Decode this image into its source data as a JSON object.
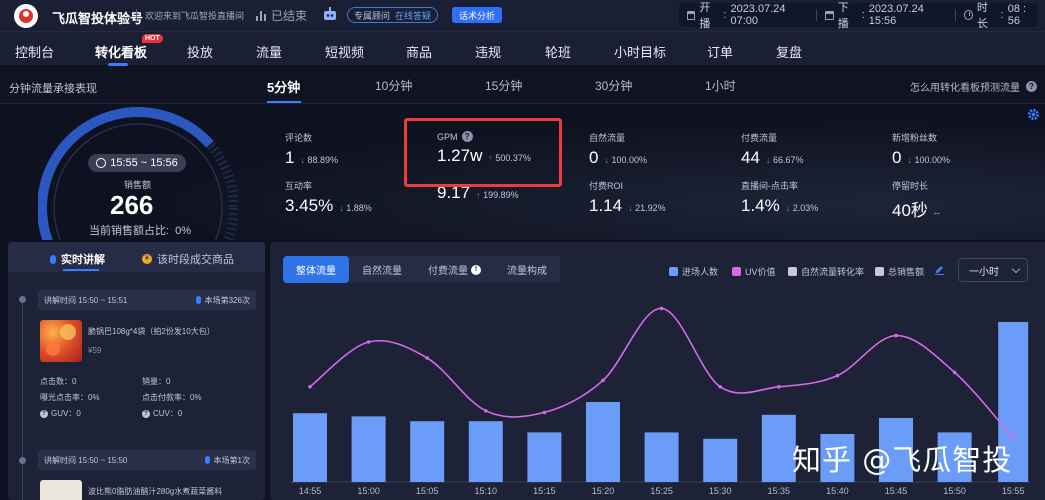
{
  "header": {
    "brand": "飞瓜智投体验号",
    "welcome": "欢迎来到飞瓜智投直播间",
    "status": "已结束",
    "consult": {
      "label": "专属顾问",
      "online": "在线答疑"
    },
    "analyze_button": "话术分析",
    "start": {
      "label": "开播",
      "value": "2023.07.24 07:00"
    },
    "end": {
      "label": "下播",
      "value": "2023.07.24 15:56"
    },
    "duration": {
      "label": "时长",
      "value": "08 : 56"
    }
  },
  "nav": {
    "items": [
      "控制台",
      "转化看板",
      "投放",
      "流量",
      "短视频",
      "商品",
      "违规",
      "轮班",
      "小时目标",
      "订单",
      "复盘"
    ],
    "active_index": 1,
    "hot_badge": "HOT"
  },
  "subbar": {
    "title": "分钟流量承接表现",
    "intervals": [
      "5分钟",
      "10分钟",
      "15分钟",
      "30分钟",
      "1小时"
    ],
    "active_index": 0,
    "help_link": "怎么用转化看板预测流量",
    "help_icon": "?"
  },
  "gauge": {
    "time_range": "15:55 ~ 15:56",
    "label": "销售额",
    "value": "266",
    "share_label": "当前销售额占比:",
    "share_value": "0%",
    "fill_fraction": 0.78
  },
  "metrics": [
    {
      "label": "评论数",
      "value": "1",
      "dir": "down",
      "change": "88.89%"
    },
    {
      "label": "GPM",
      "value": "1.27w",
      "dir": "up",
      "change": "500.37%",
      "help": true
    },
    {
      "label": "自然流量",
      "value": "0",
      "dir": "down",
      "change": "100.00%"
    },
    {
      "label": "付费流量",
      "value": "44",
      "dir": "down",
      "change": "66.67%"
    },
    {
      "label": "新增粉丝数",
      "value": "0",
      "dir": "down",
      "change": "100.00%"
    },
    {
      "label": "互动率",
      "value": "3.45%",
      "dir": "down",
      "change": "1.88%"
    },
    {
      "label": "",
      "value": "9.17",
      "dir": "up",
      "change": "199.89%"
    },
    {
      "label": "付费ROI",
      "value": "1.14",
      "dir": "down",
      "change": "21.92%"
    },
    {
      "label": "直播间-点击率",
      "value": "1.4%",
      "dir": "down",
      "change": "2.03%"
    },
    {
      "label": "停留时长",
      "value": "40秒",
      "dir": "",
      "change": "--"
    }
  ],
  "left_panel": {
    "tabs": [
      "实时讲解",
      "该时段成交商品"
    ],
    "active_tab": 0,
    "cards": [
      {
        "time": "讲解时间 15:50 ~ 15:51",
        "rank": "本场第326次",
        "product": "脆锅巴108g*4袋（拍2份发10大包）",
        "price": "¥59",
        "clicks": "点击数：0",
        "sales": "销量：0",
        "exposure_ctr": "曝光点击率：0%",
        "click_pay_rate": "点击付款率：0%",
        "guv": "GUV：0",
        "cuv": "CUV：0"
      },
      {
        "time": "讲解时间 15:50 ~ 15:50",
        "rank": "本场第1次",
        "product": "波比熊0脂肪油醋汁280g水煮蔬菜酱料"
      }
    ]
  },
  "chart_panel": {
    "tabs": [
      "整体流量",
      "自然流量",
      "付费流量",
      "流量构成"
    ],
    "active_tab": 0,
    "paid_tab_alert": "!",
    "legend": [
      "进场人数",
      "UV价值",
      "自然流量转化率",
      "总销售额"
    ],
    "legend_colors": [
      "#6b9cf7",
      "#d46ae6",
      "#c9cbd4",
      "#c9cbd4"
    ],
    "range": "一小时"
  },
  "chart_data": {
    "type": "bar",
    "x": [
      "14:55",
      "15:00",
      "15:05",
      "15:10",
      "15:15",
      "15:20",
      "15:25",
      "15:30",
      "15:35",
      "15:40",
      "15:45",
      "15:50",
      "15:55"
    ],
    "series": [
      {
        "name": "进场人数",
        "values": [
          0.43,
          0.41,
          0.38,
          0.38,
          0.31,
          0.5,
          0.31,
          0.27,
          0.42,
          0.3,
          0.4,
          0.31,
          1.0
        ],
        "color": "#6b9cf7"
      },
      {
        "name": "UV价值",
        "values": [
          0.52,
          0.8,
          0.7,
          0.37,
          0.36,
          0.56,
          1.01,
          0.52,
          0.52,
          0.59,
          0.84,
          0.61,
          0.2
        ],
        "color": "#d46ae6"
      }
    ]
  },
  "watermark": "知乎 @飞瓜智投"
}
